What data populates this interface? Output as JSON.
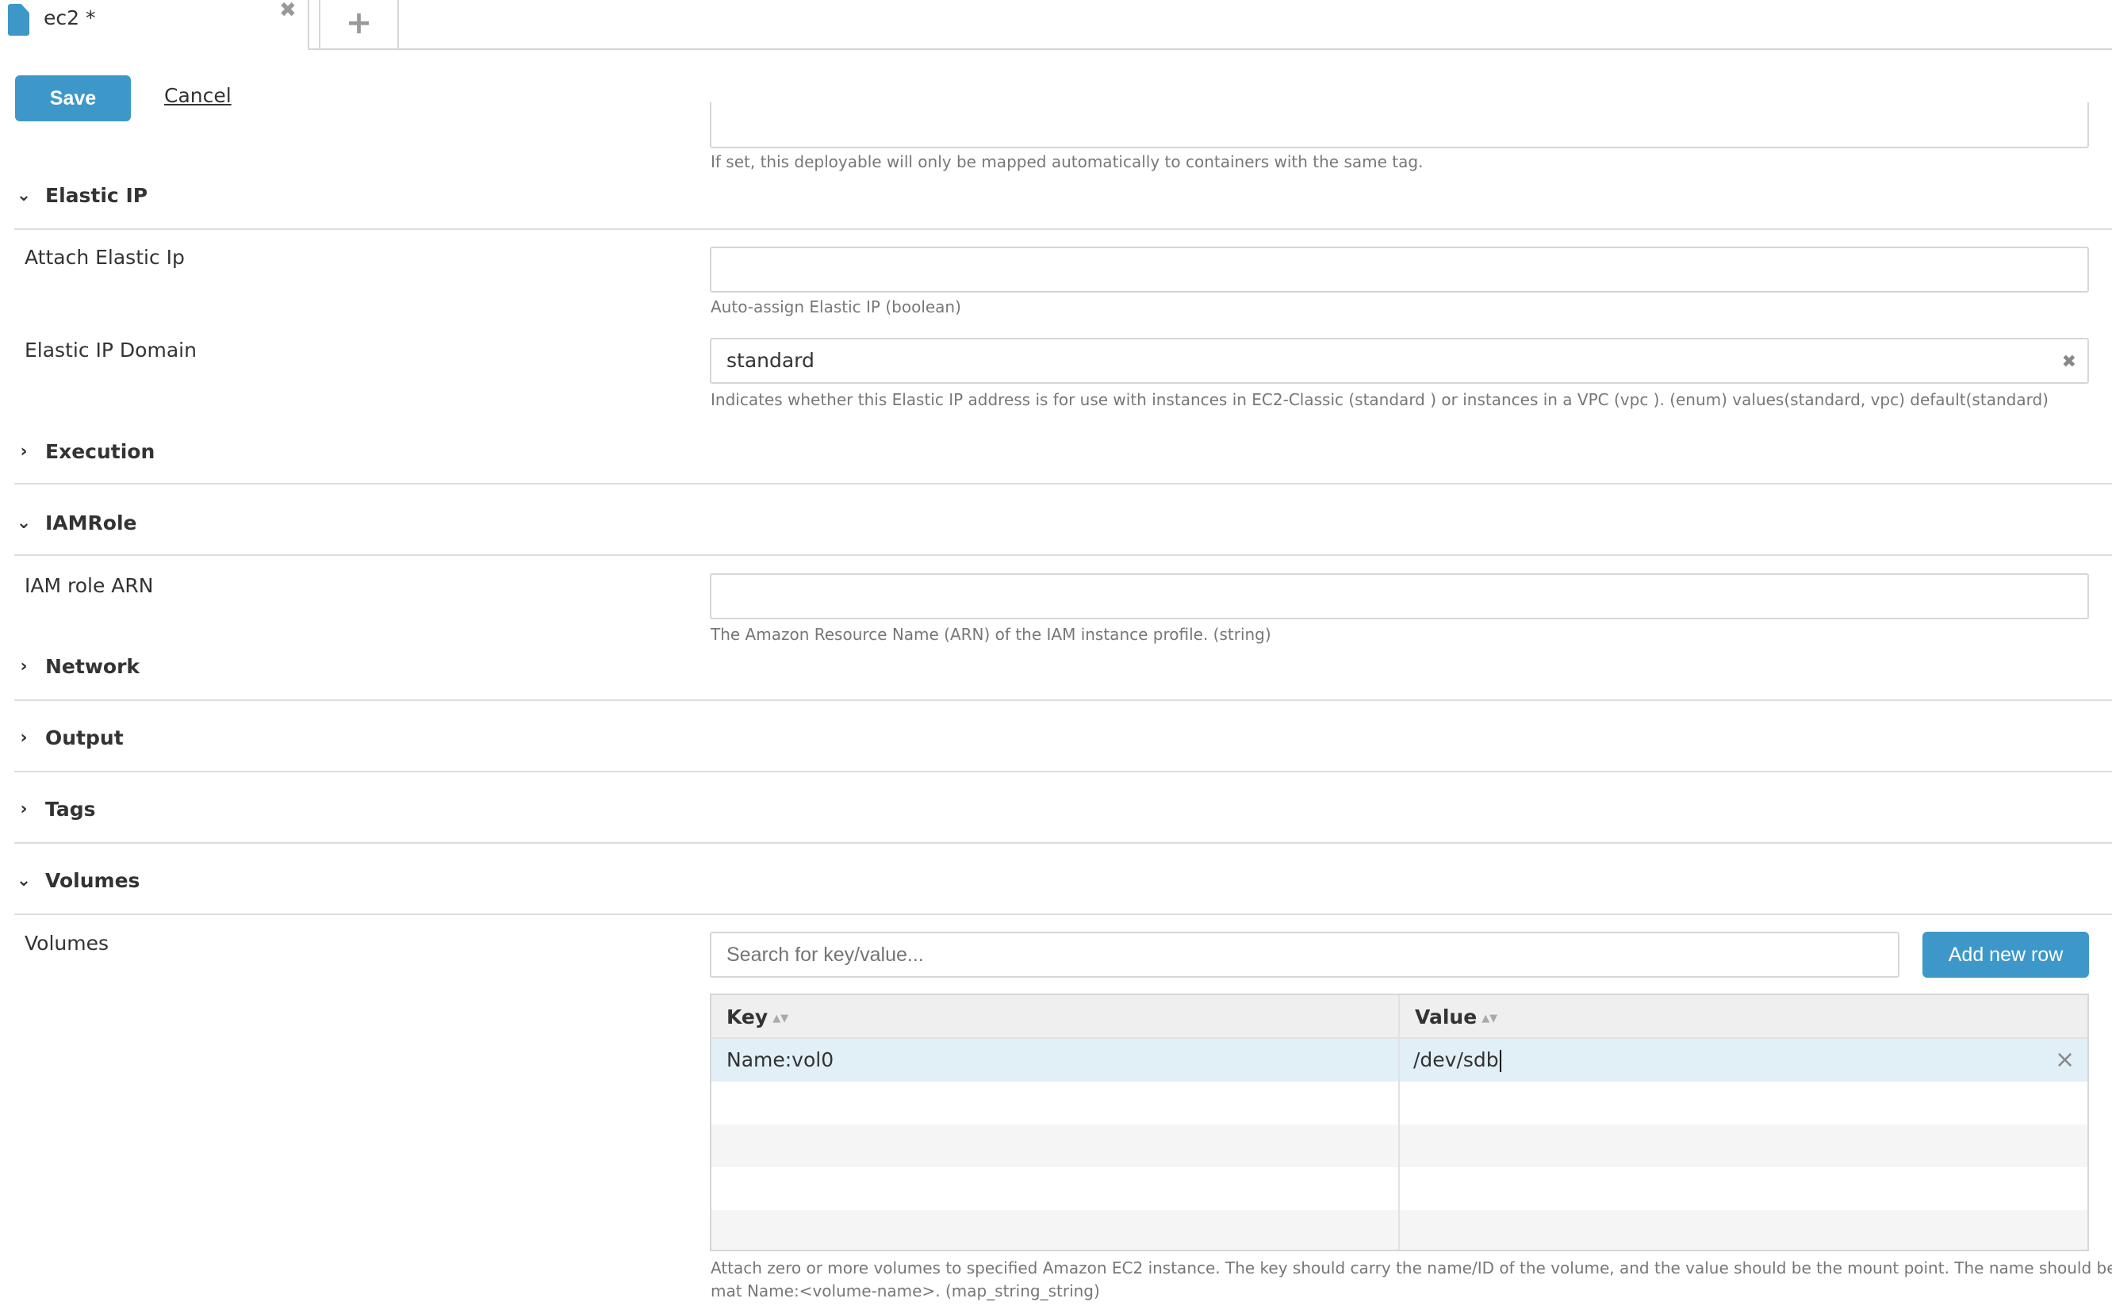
{
  "tab": {
    "title": "ec2 *",
    "close": "✖",
    "add": "+"
  },
  "toolbar": {
    "save_label": "Save",
    "cancel_label": "Cancel"
  },
  "tags_help": "If set, this deployable will only be mapped automatically to containers with the same tag.",
  "sections": {
    "elastic_ip": {
      "title": "Elastic IP",
      "expanded": true,
      "attach_label": "Attach Elastic Ip",
      "attach_value": "",
      "attach_help": "Auto-assign Elastic IP (boolean)",
      "domain_label": "Elastic IP Domain",
      "domain_value": "standard",
      "domain_help": "Indicates whether this Elastic IP address is for use with instances in EC2-Classic (standard ) or instances in a VPC (vpc ). (enum) values(standard, vpc) default(standard)"
    },
    "execution": {
      "title": "Execution",
      "expanded": false
    },
    "iamrole": {
      "title": "IAMRole",
      "expanded": true,
      "arn_label": "IAM role ARN",
      "arn_value": "",
      "arn_help": "The Amazon Resource Name (ARN) of the IAM instance profile. (string)"
    },
    "network": {
      "title": "Network",
      "expanded": false
    },
    "output": {
      "title": "Output",
      "expanded": false
    },
    "tags": {
      "title": "Tags",
      "expanded": false
    },
    "volumes": {
      "title": "Volumes",
      "expanded": true,
      "label": "Volumes",
      "search_placeholder": "Search for key/value...",
      "add_row_label": "Add new row",
      "columns": [
        "Key",
        "Value"
      ],
      "rows": [
        {
          "key": "Name:vol0",
          "value": "/dev/sdb"
        }
      ],
      "help_line1": "Attach zero or more volumes to specified Amazon EC2 instance. The key should carry the name/ID of the volume, and the value should be the mount point. The name should be in the for",
      "help_line2": "mat Name:<volume-name>. (map_string_string)"
    }
  }
}
